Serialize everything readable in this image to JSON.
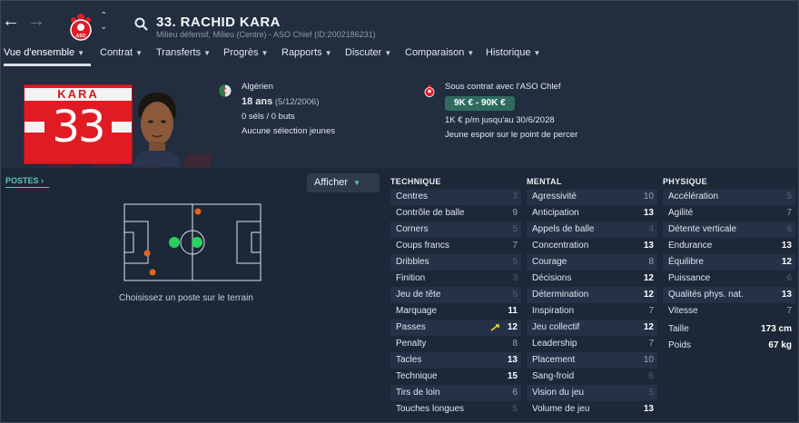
{
  "header": {
    "title": "33. RACHID KARA",
    "subtitle": "Milieu défensif, Milieu (Centre) - ASO Chlef (ID:2002186231)",
    "club_badge_text": "ASO"
  },
  "tabs": [
    {
      "label": "Vue d'ensemble"
    },
    {
      "label": "Contrat"
    },
    {
      "label": "Transferts"
    },
    {
      "label": "Progrès"
    },
    {
      "label": "Rapports"
    },
    {
      "label": "Discuter"
    },
    {
      "label": "Comparaison"
    },
    {
      "label": "Historique"
    }
  ],
  "kit": {
    "name": "KARA",
    "number": "33"
  },
  "personal": {
    "nationality": "Algérien",
    "age": "18 ans",
    "dob": "(5/12/2006)",
    "caps": "0 séls / 0 buts",
    "youth": "Aucune sélection jeunes"
  },
  "contract": {
    "club": "Sous contrat avec l'ASO Chlef",
    "value_range": "9K € - 90K €",
    "wage": "1K € p/m jusqu'au 30/6/2028",
    "status": "Jeune espoir sur le point de percer"
  },
  "positions": {
    "label": "POSTES",
    "show_button": "Afficher",
    "caption": "Choisissez un poste sur le terrain"
  },
  "technique": {
    "title": "TECHNIQUE",
    "rows": [
      {
        "name": "Centres",
        "value": "3"
      },
      {
        "name": "Contrôle de balle",
        "value": "9"
      },
      {
        "name": "Corners",
        "value": "5"
      },
      {
        "name": "Coups francs",
        "value": "7"
      },
      {
        "name": "Dribbles",
        "value": "5"
      },
      {
        "name": "Finition",
        "value": "3"
      },
      {
        "name": "Jeu de tête",
        "value": "5"
      },
      {
        "name": "Marquage",
        "value": "11"
      },
      {
        "name": "Passes",
        "value": "12"
      },
      {
        "name": "Penalty",
        "value": "8"
      },
      {
        "name": "Tacles",
        "value": "13"
      },
      {
        "name": "Technique",
        "value": "15"
      },
      {
        "name": "Tirs de loin",
        "value": "6"
      },
      {
        "name": "Touches longues",
        "value": "5"
      }
    ]
  },
  "mental": {
    "title": "MENTAL",
    "rows": [
      {
        "name": "Agressivité",
        "value": "10"
      },
      {
        "name": "Anticipation",
        "value": "13"
      },
      {
        "name": "Appels de balle",
        "value": "4"
      },
      {
        "name": "Concentration",
        "value": "13"
      },
      {
        "name": "Courage",
        "value": "8"
      },
      {
        "name": "Décisions",
        "value": "12"
      },
      {
        "name": "Détermination",
        "value": "12"
      },
      {
        "name": "Inspiration",
        "value": "7"
      },
      {
        "name": "Jeu collectif",
        "value": "12"
      },
      {
        "name": "Leadership",
        "value": "7"
      },
      {
        "name": "Placement",
        "value": "10"
      },
      {
        "name": "Sang-froid",
        "value": "6"
      },
      {
        "name": "Vision du jeu",
        "value": "5"
      },
      {
        "name": "Volume de jeu",
        "value": "13"
      }
    ]
  },
  "physique": {
    "title": "PHYSIQUE",
    "rows": [
      {
        "name": "Accélération",
        "value": "5"
      },
      {
        "name": "Agilité",
        "value": "7"
      },
      {
        "name": "Détente verticale",
        "value": "6"
      },
      {
        "name": "Endurance",
        "value": "13"
      },
      {
        "name": "Équilibre",
        "value": "12"
      },
      {
        "name": "Puissance",
        "value": "6"
      },
      {
        "name": "Qualités phys. nat.",
        "value": "13"
      },
      {
        "name": "Vitesse",
        "value": "7"
      }
    ],
    "height_label": "Taille",
    "height_value": "173 cm",
    "weight_label": "Poids",
    "weight_value": "67 kg"
  },
  "colors": {
    "accent": "#59c7b3",
    "kit_red": "#e01b24",
    "improve_arrow": "#e8d23a"
  }
}
